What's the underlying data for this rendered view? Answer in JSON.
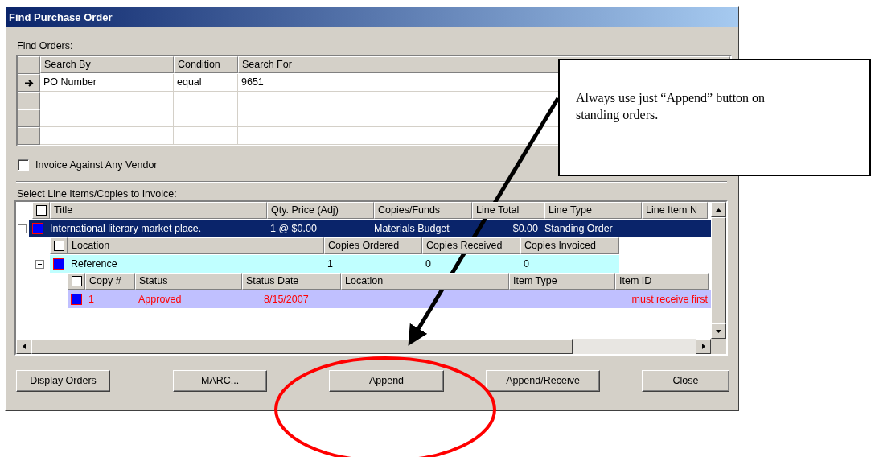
{
  "window": {
    "title": "Find Purchase Order"
  },
  "find_orders": {
    "label": "Find Orders:",
    "columns": [
      "Search By",
      "Condition",
      "Search For"
    ],
    "rows": [
      {
        "current": true,
        "search_by": "PO Number",
        "condition": "equal",
        "search_for": "9651"
      },
      {
        "current": false
      },
      {
        "current": false
      },
      {
        "current": false
      }
    ]
  },
  "invoice_against_any_vendor": {
    "label": "Invoice Against Any Vendor",
    "checked": false
  },
  "line_items": {
    "label": "Select Line Items/Copies to Invoice:",
    "header_checks": [
      {
        "checked": false
      },
      {
        "checked": false
      },
      {
        "checked": false
      }
    ],
    "columns": [
      "Title",
      "Qty.  Price (Adj)",
      "Copies/Funds",
      "Line Total",
      "Line Type",
      "Line Item N"
    ],
    "location_columns": [
      "Location",
      "Copies Ordered",
      "Copies Received",
      "Copies Invoiced"
    ],
    "copy_columns": [
      "Copy #",
      "Status",
      "Status Date",
      "Location",
      "Item Type",
      "Item ID"
    ],
    "items": [
      {
        "title": "International literary market place.",
        "qty_price": "1 @ $0.00",
        "copies_funds": "Materials Budget",
        "line_total": "$0.00",
        "line_type": "Standing Order",
        "selected": true,
        "expanded": true,
        "locations": [
          {
            "location": "Reference",
            "copies_ordered": "1",
            "copies_received": "0",
            "copies_invoiced": "0",
            "expanded": true,
            "copies": [
              {
                "copy": "1",
                "status": "Approved",
                "status_date": "8/15/2007",
                "item_id": "must receive first"
              }
            ]
          }
        ]
      }
    ]
  },
  "buttons": [
    {
      "text_before": "Display Orders"
    },
    {
      "text_before": "MARC..."
    },
    {
      "access_key": "A",
      "text_after": "ppend"
    },
    {
      "text_before": "Append/",
      "access_key": "R",
      "text_after": "eceive"
    },
    {
      "access_key": "C",
      "text_after": "lose"
    }
  ],
  "callout": {
    "text": "Always use just “Append” button on standing orders."
  }
}
